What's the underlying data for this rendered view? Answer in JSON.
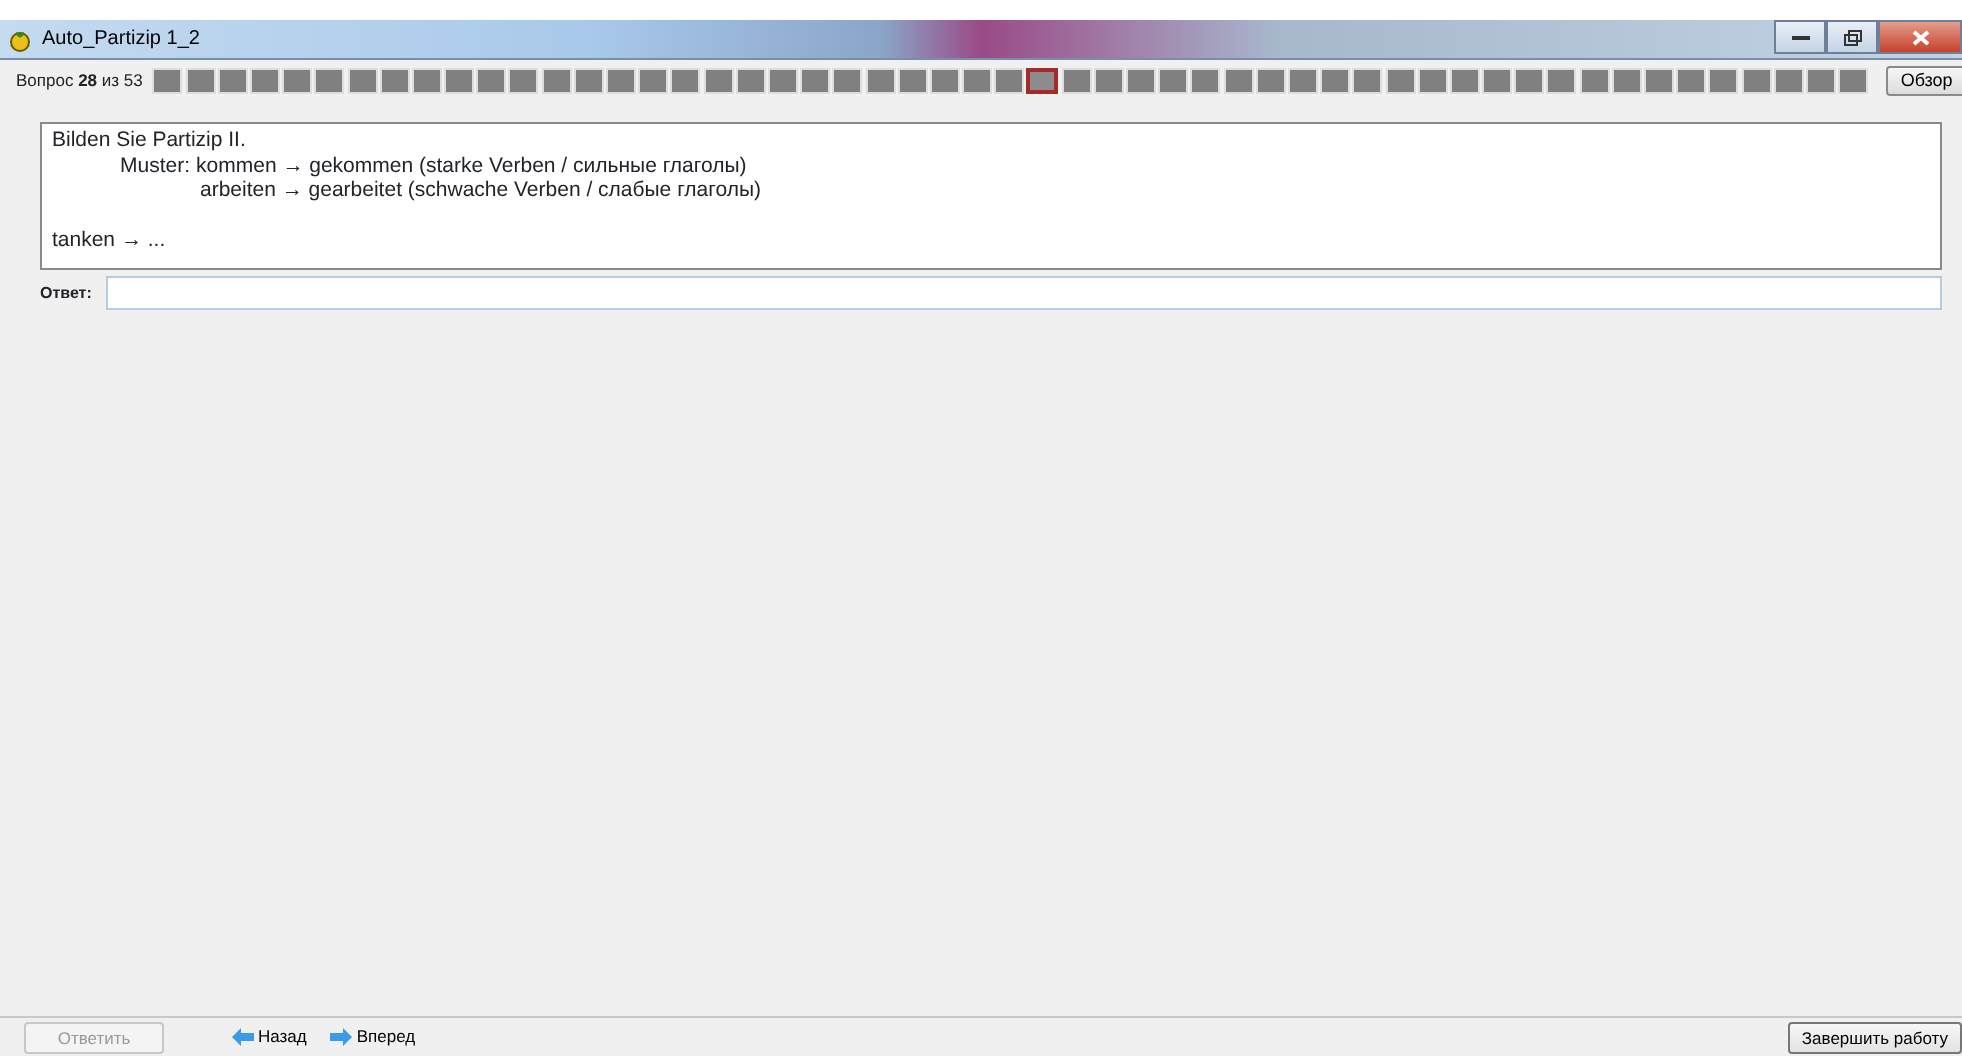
{
  "window": {
    "title": "Auto_Partizip 1_2"
  },
  "progress": {
    "label_prefix": "Вопрос",
    "current": "28",
    "label_of": "из",
    "total": "53"
  },
  "questions": [
    {
      "selected": false
    },
    {
      "selected": false
    },
    {
      "selected": false
    },
    {
      "selected": false
    },
    {
      "selected": false
    },
    {
      "selected": false
    },
    {
      "selected": false
    },
    {
      "selected": false
    },
    {
      "selected": false
    },
    {
      "selected": false
    },
    {
      "selected": false
    },
    {
      "selected": false
    },
    {
      "selected": false
    },
    {
      "selected": false
    },
    {
      "selected": false
    },
    {
      "selected": false
    },
    {
      "selected": false
    },
    {
      "selected": false
    },
    {
      "selected": false
    },
    {
      "selected": false
    },
    {
      "selected": false
    },
    {
      "selected": false
    },
    {
      "selected": false
    },
    {
      "selected": false
    },
    {
      "selected": false
    },
    {
      "selected": false
    },
    {
      "selected": false
    },
    {
      "selected": true
    },
    {
      "selected": false
    },
    {
      "selected": false
    },
    {
      "selected": false
    },
    {
      "selected": false
    },
    {
      "selected": false
    },
    {
      "selected": false
    },
    {
      "selected": false
    },
    {
      "selected": false
    },
    {
      "selected": false
    },
    {
      "selected": false
    },
    {
      "selected": false
    },
    {
      "selected": false
    },
    {
      "selected": false
    },
    {
      "selected": false
    },
    {
      "selected": false
    },
    {
      "selected": false
    },
    {
      "selected": false
    },
    {
      "selected": false
    },
    {
      "selected": false
    },
    {
      "selected": false
    },
    {
      "selected": false
    },
    {
      "selected": false
    },
    {
      "selected": false
    },
    {
      "selected": false
    },
    {
      "selected": false
    }
  ],
  "overview_button": "Обзор",
  "question": {
    "lines": [
      {
        "kind": "plain",
        "text": "Bilden Sie Partizip II."
      },
      {
        "kind": "label",
        "label": "Muster:",
        "text": "kommen → gekommen (starke Verben / сильные глаголы)"
      },
      {
        "kind": "indent",
        "text": "arbeiten → gearbeitet (schwache Verben / слабые глаголы)"
      },
      {
        "kind": "gap"
      },
      {
        "kind": "plain",
        "text": "tanken → ..."
      }
    ]
  },
  "answer": {
    "label": "Ответ:"
  },
  "footer": {
    "answer_button": {
      "label": "Ответить",
      "disabled": true
    },
    "back": "Назад",
    "forward": "Вперед",
    "finish": "Завершить работу"
  }
}
